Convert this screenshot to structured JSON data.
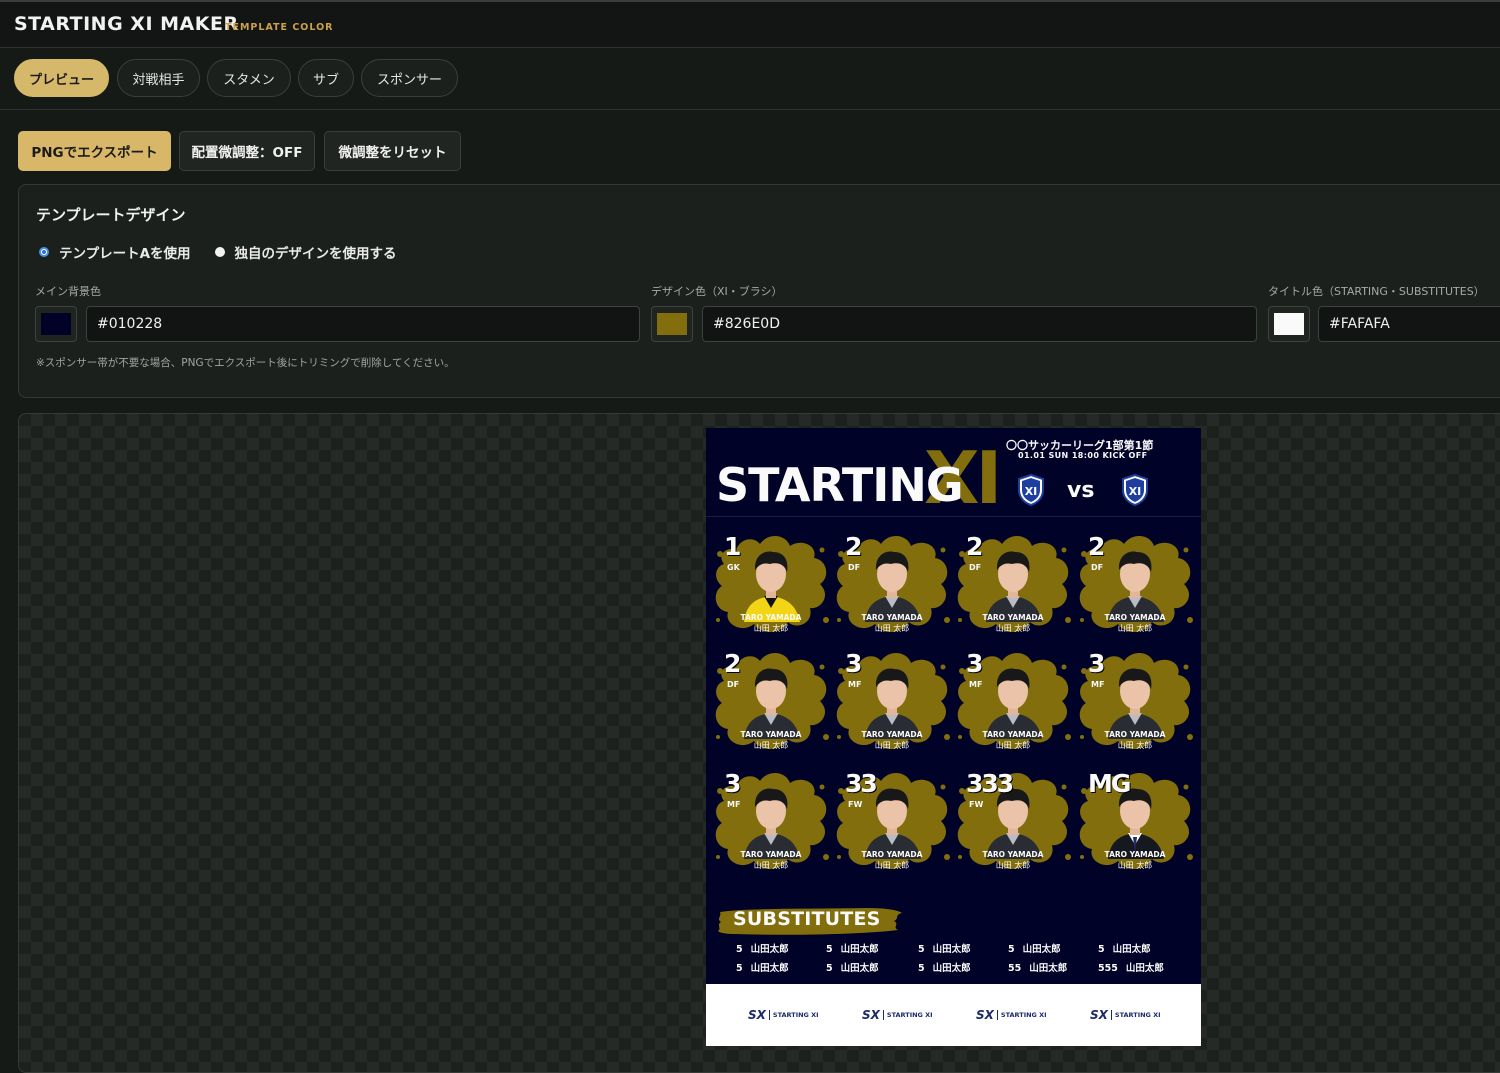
{
  "app": {
    "title": "STARTING XI MAKER",
    "subtitle": "TEMPLATE COLOR"
  },
  "tabs": [
    {
      "label": "プレビュー",
      "active": true
    },
    {
      "label": "対戦相手",
      "active": false
    },
    {
      "label": "スタメン",
      "active": false
    },
    {
      "label": "サブ",
      "active": false
    },
    {
      "label": "スポンサー",
      "active": false
    }
  ],
  "toolbar": {
    "export_label": "PNGでエクスポート",
    "adjust_label": "配置微調整：OFF",
    "reset_label": "微調整をリセット"
  },
  "template_panel": {
    "title": "テンプレートデザイン",
    "radio_a_label": "テンプレートAを使用",
    "radio_a_selected": true,
    "radio_custom_label": "独自のデザインを使用する",
    "radio_custom_selected": false,
    "fields": [
      {
        "label": "メイン背景色",
        "value": "#010228"
      },
      {
        "label": "デザイン色（XI・ブラシ）",
        "value": "#826E0D"
      },
      {
        "label": "タイトル色（STARTING・SUBSTITUTES）",
        "value": "#FAFAFA"
      }
    ],
    "note": "※スポンサー帯が不要な場合、PNGでエクスポート後にトリミングで削除してください。"
  },
  "poster": {
    "league": "〇〇サッカーリーグ1部第1節",
    "kickoff": "01.01 SUN 18:00 KICK OFF",
    "title_word": "STARTING",
    "title_xi": "XI",
    "vs": "vs",
    "crest_label": "XI",
    "players": [
      {
        "number": "1",
        "position": "GK",
        "name_en": "TARO YAMADA",
        "name_jp": "山田 太郎",
        "kit": "gk"
      },
      {
        "number": "2",
        "position": "DF",
        "name_en": "TARO YAMADA",
        "name_jp": "山田 太郎",
        "kit": "field"
      },
      {
        "number": "2",
        "position": "DF",
        "name_en": "TARO YAMADA",
        "name_jp": "山田 太郎",
        "kit": "field"
      },
      {
        "number": "2",
        "position": "DF",
        "name_en": "TARO YAMADA",
        "name_jp": "山田 太郎",
        "kit": "field"
      },
      {
        "number": "2",
        "position": "DF",
        "name_en": "TARO YAMADA",
        "name_jp": "山田 太郎",
        "kit": "field"
      },
      {
        "number": "3",
        "position": "MF",
        "name_en": "TARO YAMADA",
        "name_jp": "山田 太郎",
        "kit": "field"
      },
      {
        "number": "3",
        "position": "MF",
        "name_en": "TARO YAMADA",
        "name_jp": "山田 太郎",
        "kit": "field"
      },
      {
        "number": "3",
        "position": "MF",
        "name_en": "TARO YAMADA",
        "name_jp": "山田 太郎",
        "kit": "field"
      },
      {
        "number": "3",
        "position": "MF",
        "name_en": "TARO YAMADA",
        "name_jp": "山田 太郎",
        "kit": "field"
      },
      {
        "number": "33",
        "position": "FW",
        "name_en": "TARO YAMADA",
        "name_jp": "山田 太郎",
        "kit": "field"
      },
      {
        "number": "333",
        "position": "FW",
        "name_en": "TARO YAMADA",
        "name_jp": "山田 太郎",
        "kit": "field"
      },
      {
        "number": "MG",
        "position": "",
        "name_en": "TARO YAMADA",
        "name_jp": "山田 太郎",
        "kit": "suit"
      }
    ],
    "substitutes_title": "SUBSTITUTES",
    "substitutes": [
      {
        "number": "5",
        "name": "山田太郎"
      },
      {
        "number": "5",
        "name": "山田太郎"
      },
      {
        "number": "5",
        "name": "山田太郎"
      },
      {
        "number": "5",
        "name": "山田太郎"
      },
      {
        "number": "5",
        "name": "山田太郎"
      },
      {
        "number": "5",
        "name": "山田太郎"
      },
      {
        "number": "5",
        "name": "山田太郎"
      },
      {
        "number": "5",
        "name": "山田太郎"
      },
      {
        "number": "55",
        "name": "山田太郎"
      },
      {
        "number": "555",
        "name": "山田太郎"
      }
    ],
    "sponsors": [
      {
        "mark": "SX",
        "text": "STARTING XI"
      },
      {
        "mark": "SX",
        "text": "STARTING XI"
      },
      {
        "mark": "SX",
        "text": "STARTING XI"
      },
      {
        "mark": "SX",
        "text": "STARTING XI"
      }
    ]
  },
  "colors": {
    "accent": "#d6b86a",
    "main_bg": "#010228",
    "design": "#826E0D",
    "title": "#FAFAFA"
  }
}
